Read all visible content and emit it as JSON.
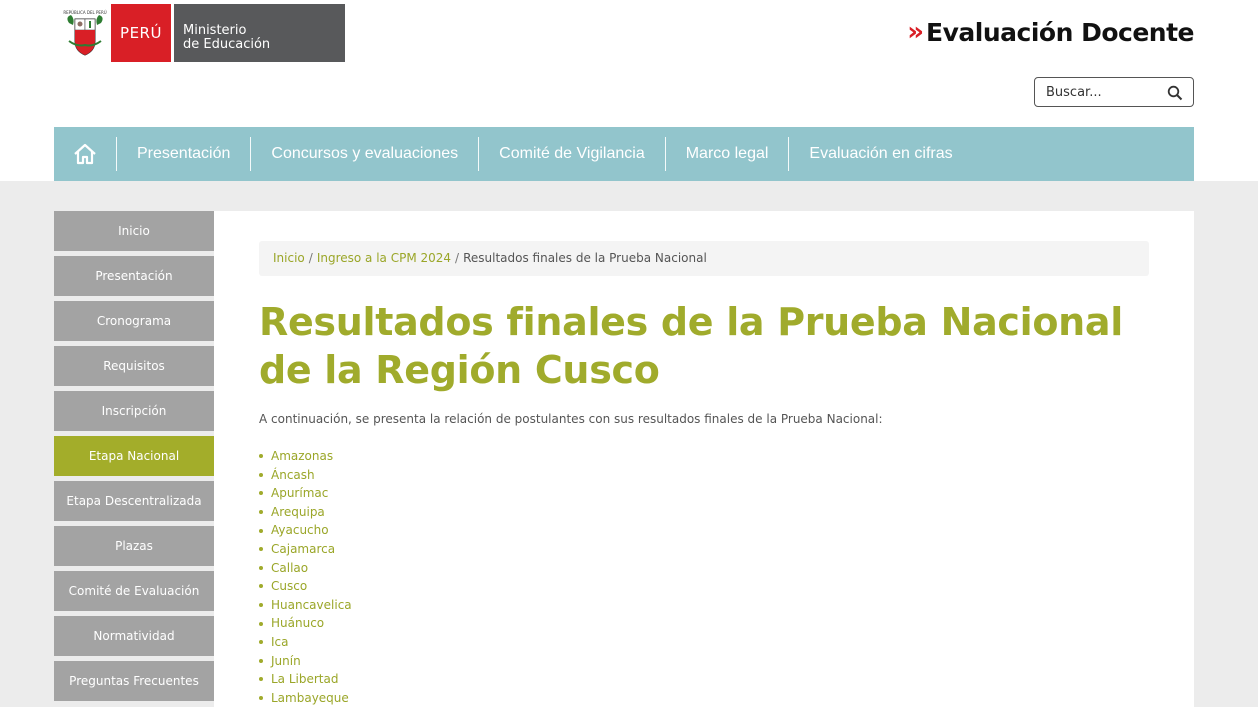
{
  "header": {
    "shield_caption": "REPÚBLICA DEL PERÚ",
    "peru_label": "PERÚ",
    "ministry_line1": "Ministerio",
    "ministry_line2": "de Educación",
    "brand_chevrons": "»",
    "brand_text": "Evaluación Docente",
    "search_placeholder": "Buscar..."
  },
  "nav": {
    "items": [
      "Presentación",
      "Concursos y evaluaciones",
      "Comité de Vigilancia",
      "Marco legal",
      "Evaluación en cifras"
    ]
  },
  "sidebar": {
    "items": [
      {
        "label": "Inicio"
      },
      {
        "label": "Presentación"
      },
      {
        "label": "Cronograma"
      },
      {
        "label": "Requisitos"
      },
      {
        "label": "Inscripción"
      },
      {
        "label": "Etapa Nacional"
      },
      {
        "label": "Etapa Descentralizada"
      },
      {
        "label": "Plazas"
      },
      {
        "label": "Comité de Evaluación"
      },
      {
        "label": "Normatividad"
      },
      {
        "label": "Preguntas Frecuentes"
      }
    ],
    "active_index": 5
  },
  "breadcrumb": {
    "items": [
      "Inicio",
      "Ingreso a la CPM 2024",
      "Resultados finales de la Prueba Nacional"
    ],
    "separator": "/"
  },
  "main": {
    "title": "Resultados finales de la Prueba Nacional de la Región Cusco",
    "intro": "A continuación, se presenta la relación de postulantes con sus resultados finales de la Prueba Nacional:",
    "regions": [
      "Amazonas",
      "Áncash",
      "Apurímac",
      "Arequipa",
      "Ayacucho",
      "Cajamarca",
      "Callao",
      "Cusco",
      "Huancavelica",
      "Huánuco",
      "Ica",
      "Junín",
      "La Libertad",
      "Lambayeque"
    ]
  },
  "colors": {
    "accent_green": "#a0ab2c",
    "nav_teal": "#92c5cc",
    "peru_red": "#d91f26",
    "sidebar_gray": "#a3a3a3"
  }
}
